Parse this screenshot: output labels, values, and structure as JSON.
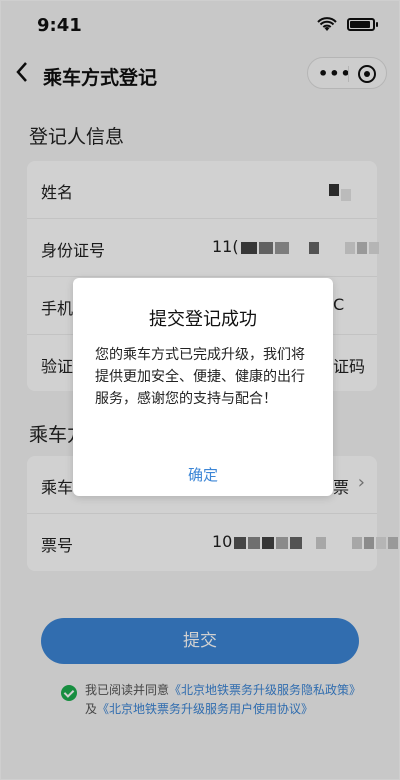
{
  "status_bar": {
    "time": "9:41"
  },
  "nav": {
    "title": "乘车方式登记",
    "more_label": "•••"
  },
  "registrant": {
    "section_title": "登记人信息",
    "rows": [
      {
        "label": "姓名",
        "value": ""
      },
      {
        "label": "身份证号",
        "value": "11("
      },
      {
        "label": "手机",
        "value": "C"
      },
      {
        "label": "验证",
        "value": "证码"
      }
    ]
  },
  "ride": {
    "section_title": "乘车方",
    "rows": [
      {
        "label": "乘车",
        "value": "票"
      },
      {
        "label": "票号",
        "value": "10"
      }
    ]
  },
  "submit": {
    "label": "提交"
  },
  "agreement": {
    "prefix": "我已阅读并同意",
    "link1": "《北京地铁票务升级服务隐私政策》",
    "join": "及",
    "link2": "《北京地铁票务升级服务用户使用协议》"
  },
  "dialog": {
    "title": "提交登记成功",
    "body": "您的乘车方式已完成升级，我们将提供更加安全、便捷、健康的出行服务，感谢您的支持与配合！",
    "confirm": "确定"
  },
  "colors": {
    "accent": "#3c86d6",
    "check": "#1dae4f"
  }
}
